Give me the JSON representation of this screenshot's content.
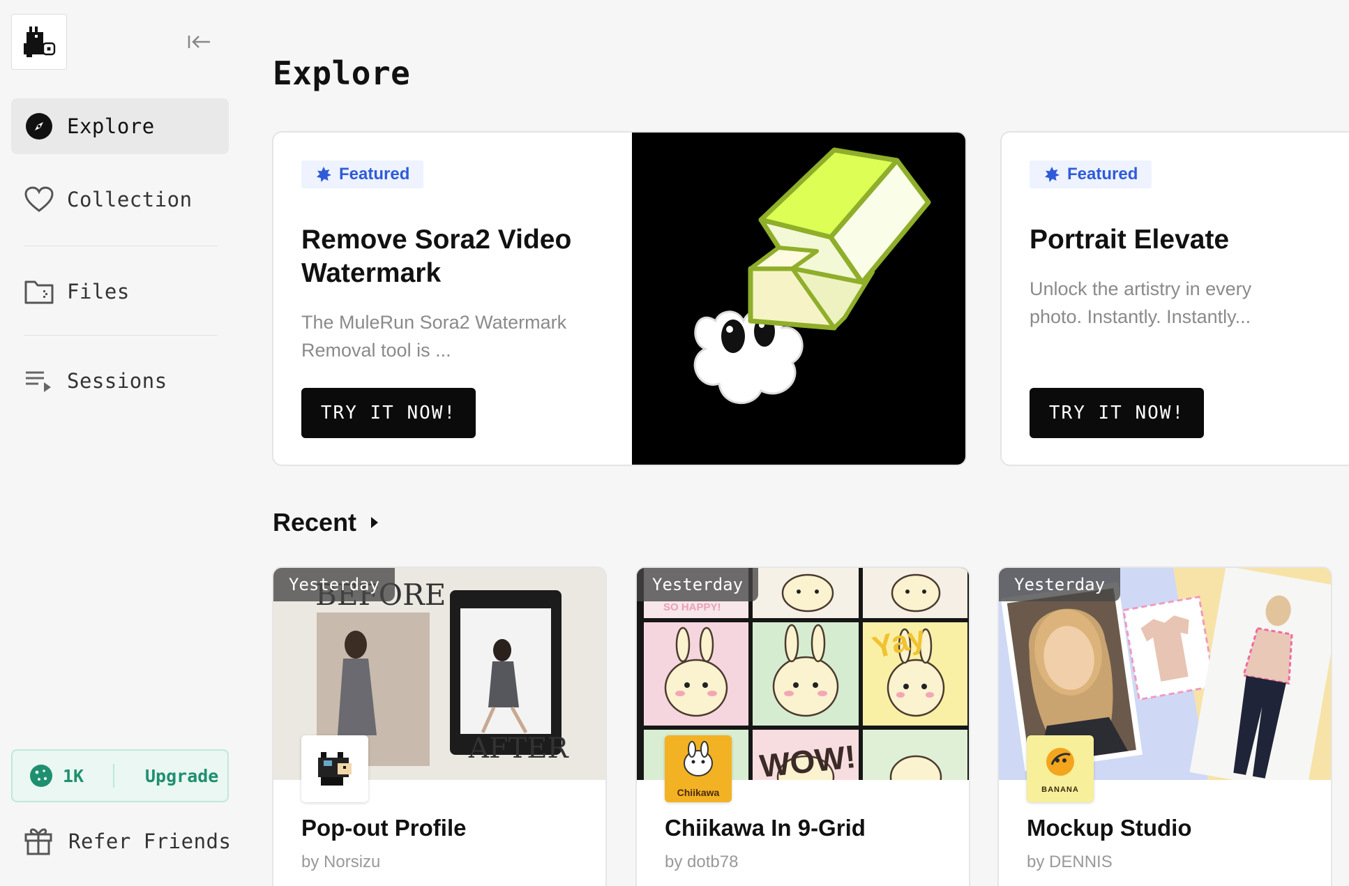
{
  "sidebar": {
    "logo_icon": "mule-pixel-logo-icon",
    "collapse_icon": "collapse-sidebar-icon",
    "nav": [
      {
        "label": "Explore",
        "icon": "compass-icon",
        "active": true
      },
      {
        "label": "Collection",
        "icon": "heart-icon",
        "active": false
      },
      {
        "label": "Files",
        "icon": "folder-icon",
        "active": false
      },
      {
        "label": "Sessions",
        "icon": "playlist-icon",
        "active": false
      }
    ],
    "credits": {
      "amount": "1K",
      "upgrade_label": "Upgrade",
      "icon": "cookie-icon"
    },
    "refer": {
      "label": "Refer Friends",
      "icon": "gift-icon"
    }
  },
  "main": {
    "title": "Explore",
    "featured": [
      {
        "badge": "Featured",
        "title": "Remove Sora2 Video Watermark",
        "description": "The MuleRun Sora2 Watermark Removal tool is ...",
        "button": "TRY IT NOW!",
        "art": "eraser-illustration"
      },
      {
        "badge": "Featured",
        "title": "Portrait Elevate",
        "description": "Unlock the artistry in every photo. Instantly. Instantly...",
        "button": "TRY IT NOW!"
      }
    ],
    "recent": {
      "title": "Recent",
      "items": [
        {
          "time": "Yesterday",
          "title": "Pop-out Profile",
          "author": "by Norsizu",
          "thumb_text_1": "BEFORE",
          "thumb_text_2": "AFTER"
        },
        {
          "time": "Yesterday",
          "title": "Chiikawa In 9-Grid",
          "author": "by dotb78",
          "avatar_text": "Chiikawa",
          "grid_text_1": "SO HAPPY!",
          "grid_text_2": "Yay",
          "grid_text_3": "WOW!"
        },
        {
          "time": "Yesterday",
          "title": "Mockup Studio",
          "author": "by DENNIS",
          "avatar_text": "BANANA"
        }
      ]
    }
  },
  "colors": {
    "accent_blue": "#2f5bd8",
    "credit_green": "#1f8f70",
    "button_black": "#0b0b0b",
    "eraser_lime": "#ddff55"
  }
}
